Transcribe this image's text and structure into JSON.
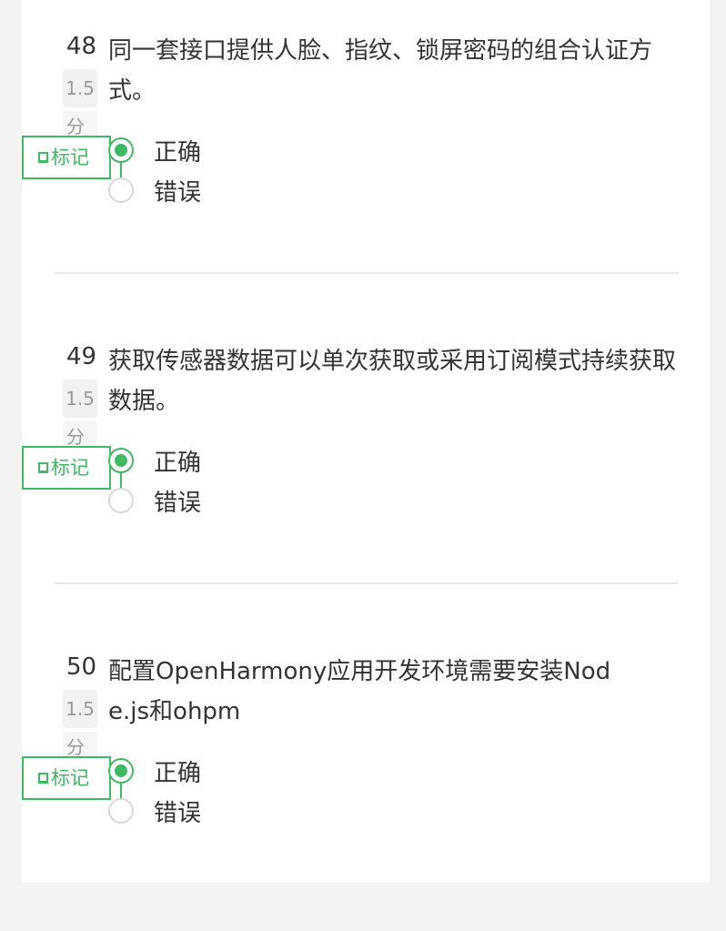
{
  "mark_label": "标记",
  "questions": [
    {
      "number": "48",
      "text": "同一套接口提供人脸、指纹、锁屏密码的组合认证方式。",
      "score": "1.5",
      "score_unit": "分",
      "options": [
        {
          "label": "正确",
          "selected": true
        },
        {
          "label": "错误",
          "selected": false
        }
      ]
    },
    {
      "number": "49",
      "text": "获取传感器数据可以单次获取或采用订阅模式持续获取数据。",
      "score": "1.5",
      "score_unit": "分",
      "options": [
        {
          "label": "正确",
          "selected": true
        },
        {
          "label": "错误",
          "selected": false
        }
      ]
    },
    {
      "number": "50",
      "text": "配置OpenHarmony应用开发环境需要安装Node.js和ohpm",
      "score": "1.5",
      "score_unit": "分",
      "options": [
        {
          "label": "正确",
          "selected": true
        },
        {
          "label": "错误",
          "selected": false
        }
      ]
    }
  ],
  "colors": {
    "accent": "#3dba63",
    "text": "#333333",
    "muted": "#9a9a9a",
    "divider": "#e8e8e8",
    "page_bg": "#f3f3f3"
  }
}
